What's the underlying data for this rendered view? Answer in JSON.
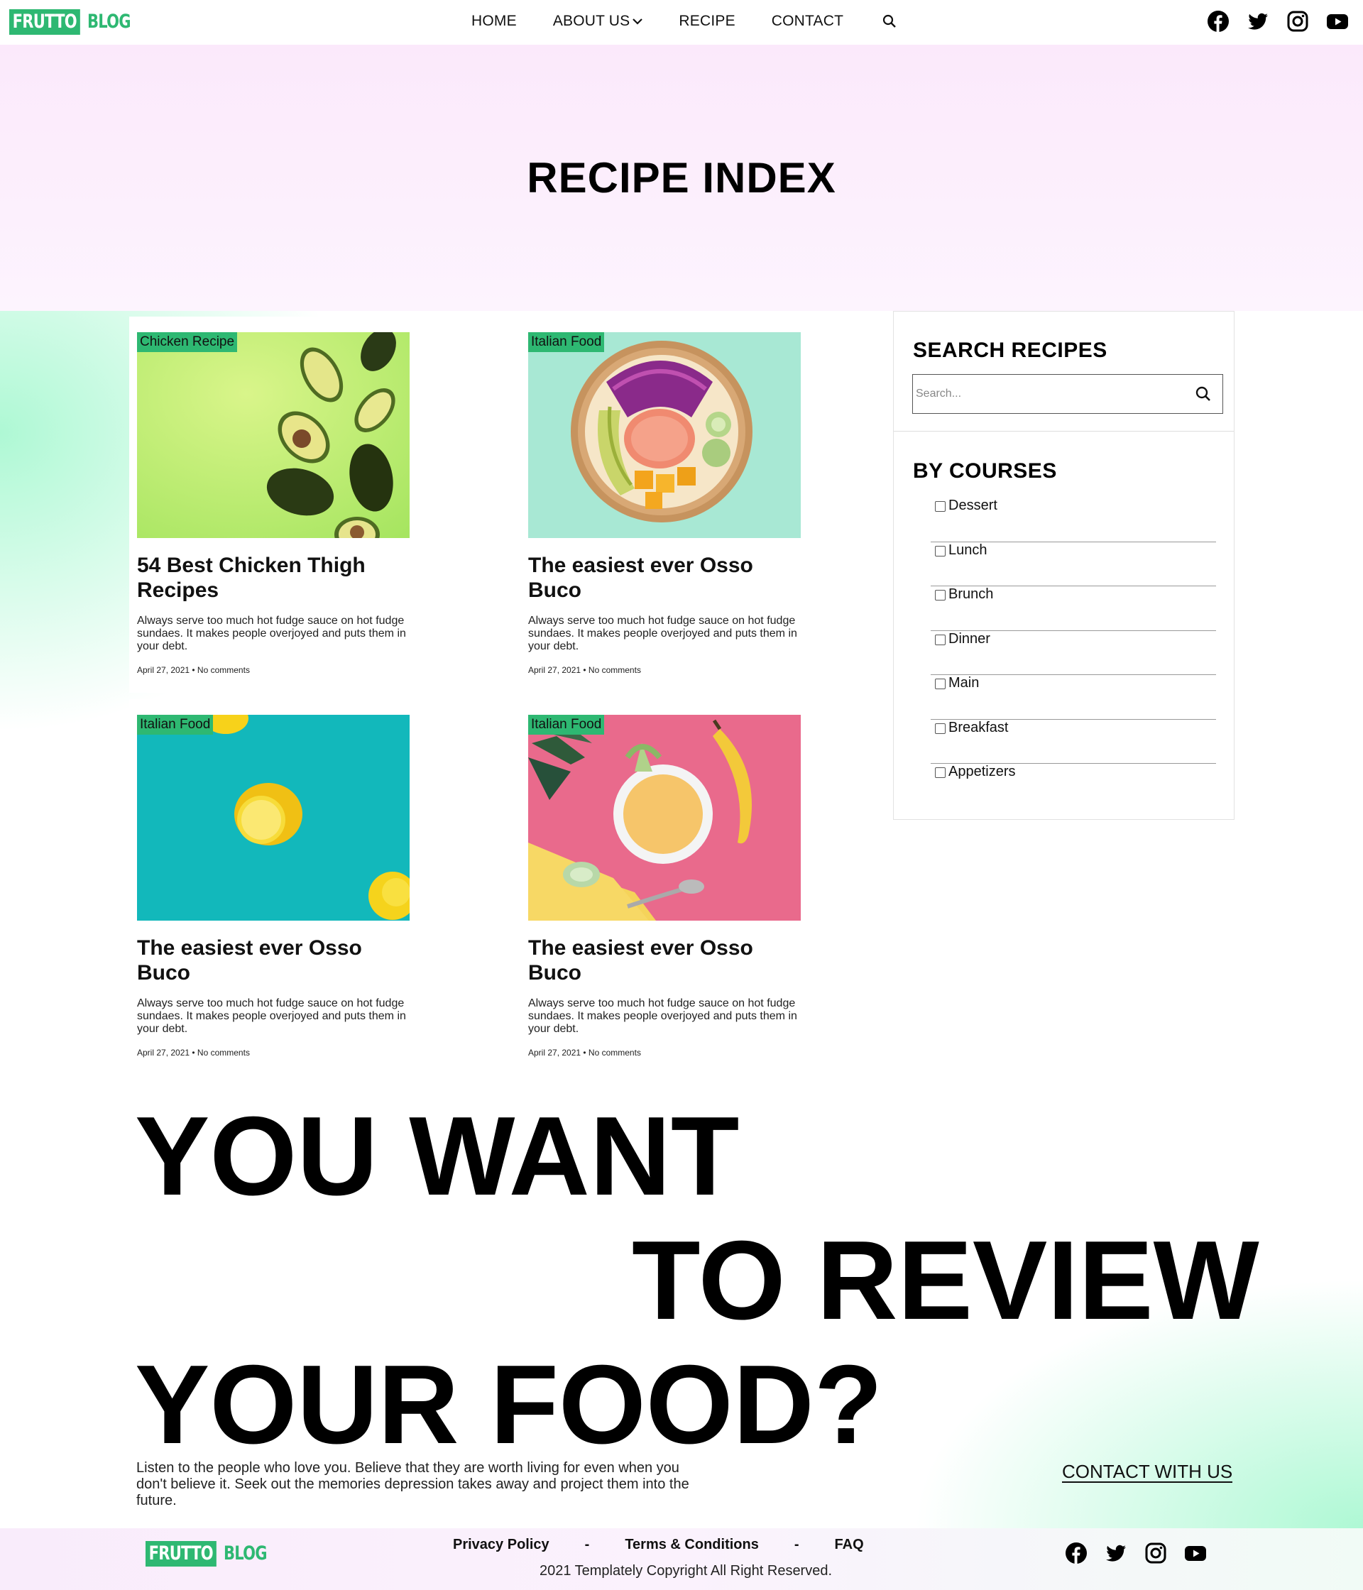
{
  "brand": {
    "box": "FRUTTO",
    "text": "BLOG",
    "color": "#2eb872"
  },
  "nav": {
    "items": [
      {
        "label": "HOME"
      },
      {
        "label": "ABOUT US",
        "has_dropdown": true
      },
      {
        "label": "RECIPE"
      },
      {
        "label": "CONTACT"
      }
    ],
    "search_icon": "search-icon"
  },
  "social_icons": [
    "facebook-icon",
    "twitter-icon",
    "instagram-icon",
    "youtube-icon"
  ],
  "hero": {
    "title": "RECIPE INDEX"
  },
  "posts": [
    {
      "tag": "Chicken Recipe",
      "title": "54 Best Chicken Thigh Recipes",
      "excerpt": "Always serve too much hot fudge sauce on hot fudge sundaes. It makes people overjoyed and puts them in your debt.",
      "meta": "April 27, 2021 • No comments",
      "image": "avocados-on-green"
    },
    {
      "tag": "Italian Food",
      "title": "The easiest ever Osso Buco",
      "excerpt": "Always serve too much hot fudge sauce on hot fudge sundaes. It makes people overjoyed and puts them in your debt.",
      "meta": "April 27, 2021 • No comments",
      "image": "poke-bowl"
    },
    {
      "tag": "Italian Food",
      "title": "The easiest ever Osso Buco",
      "excerpt": "Always serve too much hot fudge sauce on hot fudge sundaes. It makes people overjoyed and puts them in your debt.",
      "meta": "April 27, 2021 • No comments",
      "image": "lemons-on-teal"
    },
    {
      "tag": "Italian Food",
      "title": "The easiest ever Osso Buco",
      "excerpt": "Always serve too much hot fudge sauce on hot fudge sundaes. It makes people overjoyed and puts them in your debt.",
      "meta": "April 27, 2021 • No comments",
      "image": "soup-banana-pink-yellow"
    }
  ],
  "sidebar": {
    "search_title": "SEARCH RECIPES",
    "search_placeholder": "Search...",
    "search_value": "",
    "courses_title": "BY COURSES",
    "courses": [
      "Dessert",
      "Lunch",
      "Brunch",
      "Dinner",
      "Main",
      "Breakfast",
      "Appetizers"
    ]
  },
  "cta": {
    "line1": "YOU WANT",
    "line2": "TO REVIEW",
    "line3": "YOUR FOOD?",
    "text": "Listen to the people who love you. Believe that they are worth living for even when you don't believe it. Seek out the memories depression takes away and project them into the future.",
    "link": "CONTACT WITH US"
  },
  "footer": {
    "links": [
      "Privacy Policy",
      "Terms & Conditions",
      "FAQ"
    ],
    "separator": "-",
    "copyright": "2021 Templately Copyright All Right Reserved."
  }
}
